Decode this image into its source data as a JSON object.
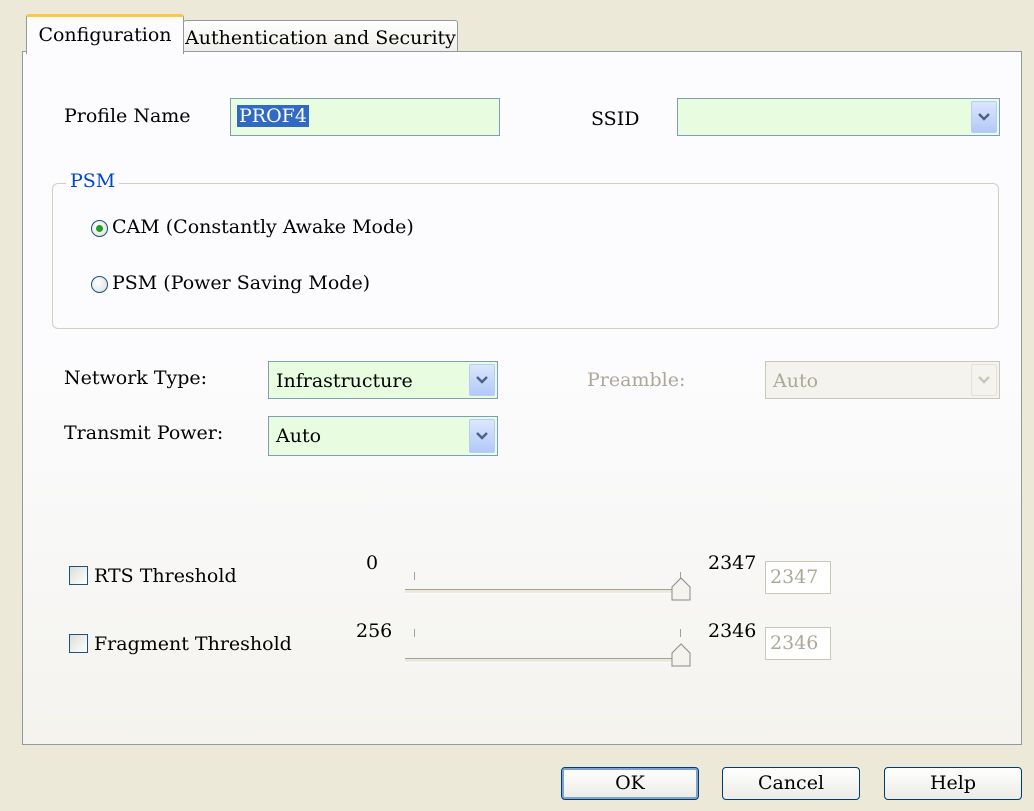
{
  "tabs": [
    {
      "label": "Configuration",
      "active": true
    },
    {
      "label": "Authentication and Security",
      "active": false
    }
  ],
  "profile": {
    "label": "Profile Name",
    "value": "PROF4"
  },
  "ssid": {
    "label": "SSID",
    "value": ""
  },
  "psm": {
    "legend": "PSM",
    "options": [
      {
        "label": "CAM (Constantly Awake Mode)",
        "selected": true
      },
      {
        "label": "PSM (Power Saving Mode)",
        "selected": false
      }
    ]
  },
  "network_type": {
    "label": "Network Type:",
    "value": "Infrastructure"
  },
  "preamble": {
    "label": "Preamble:",
    "value": "Auto",
    "enabled": false
  },
  "transmit_power": {
    "label": "Transmit Power:",
    "value": "Auto"
  },
  "rts": {
    "label": "RTS Threshold",
    "checked": false,
    "min": "0",
    "max": "2347",
    "value": "2347"
  },
  "fragment": {
    "label": "Fragment Threshold",
    "checked": false,
    "min": "256",
    "max": "2346",
    "value": "2346"
  },
  "buttons": {
    "ok": "OK",
    "cancel": "Cancel",
    "help": "Help"
  },
  "colors": {
    "background": "#ECE9D8",
    "field_bg": "#E8FCE0",
    "accent_tab": "#FFC83C",
    "legend": "#0046D5",
    "radio_dot": "#21A121"
  }
}
